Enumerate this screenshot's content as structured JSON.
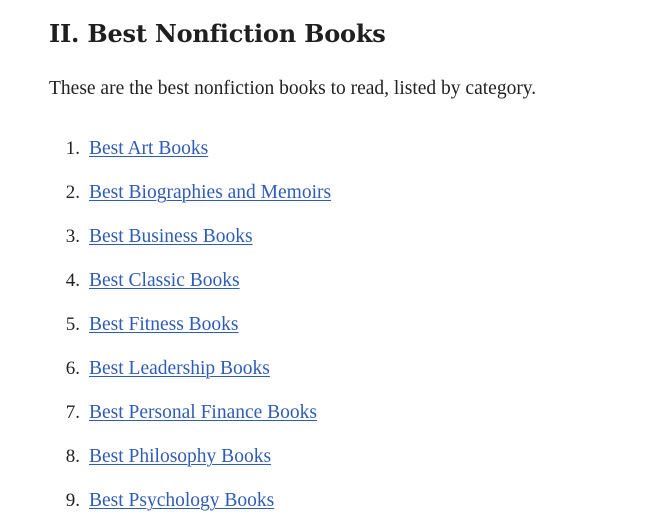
{
  "section": {
    "heading": "II. Best Nonfiction Books",
    "intro": "These are the best nonfiction books to read, listed by category."
  },
  "list": {
    "items": [
      {
        "number": "1.",
        "label": "Best Art Books"
      },
      {
        "number": "2.",
        "label": "Best Biographies and Memoirs"
      },
      {
        "number": "3.",
        "label": "Best Business Books"
      },
      {
        "number": "4.",
        "label": "Best Classic Books"
      },
      {
        "number": "5.",
        "label": "Best Fitness Books"
      },
      {
        "number": "6.",
        "label": "Best Leadership Books"
      },
      {
        "number": "7.",
        "label": "Best Personal Finance Books"
      },
      {
        "number": "8.",
        "label": "Best Philosophy Books"
      },
      {
        "number": "9.",
        "label": "Best Psychology Books"
      }
    ]
  },
  "colors": {
    "link": "#2f5cb6",
    "text": "#222222"
  }
}
